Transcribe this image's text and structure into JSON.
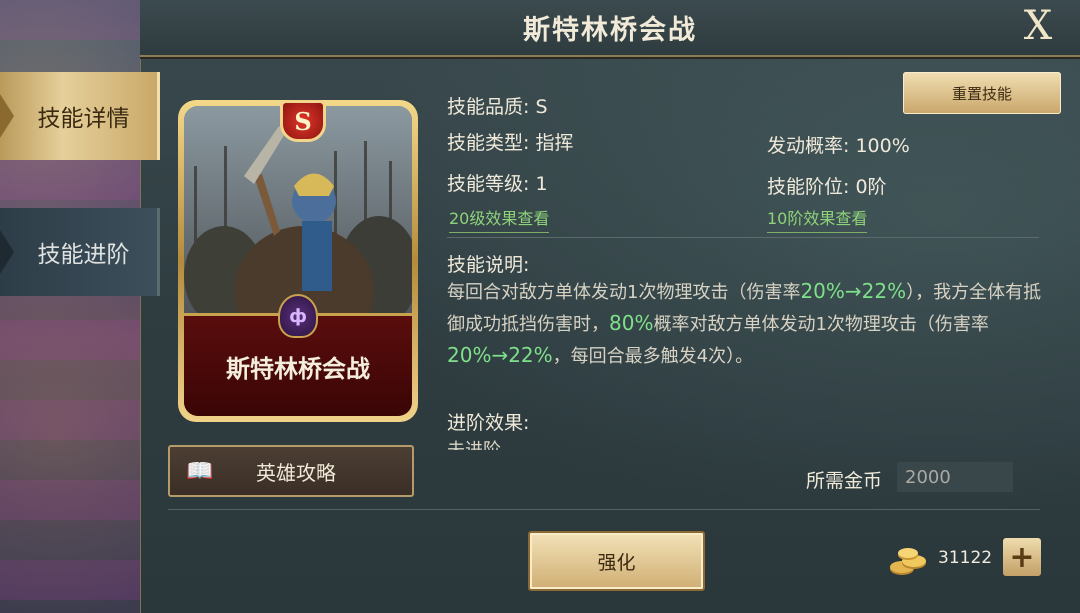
{
  "window": {
    "title": "斯特林桥会战",
    "close_label": "X"
  },
  "tabs": [
    {
      "label": "技能详情",
      "active": true
    },
    {
      "label": "技能进阶",
      "active": false
    }
  ],
  "card": {
    "grade_badge": "S",
    "name": "斯特林桥会战",
    "emblem": "ф"
  },
  "guide_button": {
    "label": "英雄攻略",
    "icon": "book-icon"
  },
  "reset_button": {
    "label": "重置技能"
  },
  "skill": {
    "quality": "技能品质: S",
    "type": "技能类型: 指挥",
    "trigger_rate": "发动概率: 100%",
    "level": "技能等级: 1",
    "tier": "技能阶位: 0阶",
    "level_link": "20级效果查看",
    "tier_link": "10阶效果查看"
  },
  "description": {
    "heading": "技能说明:",
    "part1": "每回合对敌方单体发动1次物理攻击（伤害率",
    "hl1": "20%→22%",
    "part2": "），我方全体有抵御成功抵挡伤害时，",
    "hl2": "80%",
    "part3": "概率对敌方单体发动1次物理攻击（伤害率",
    "hl3": "20%→22%",
    "part4": "，每回合最多触发4次）。"
  },
  "advance": {
    "heading": "进阶效果:",
    "text": "未进阶"
  },
  "cost": {
    "label": "所需金币",
    "value": "2000"
  },
  "enhance_button": {
    "label": "强化"
  },
  "currency": {
    "icon": "gold-coins-icon",
    "value": "31122",
    "plus_label": "+"
  },
  "colors": {
    "highlight": "#7fe08a",
    "gold": "#c9a24e",
    "link": "#8fd27a"
  }
}
